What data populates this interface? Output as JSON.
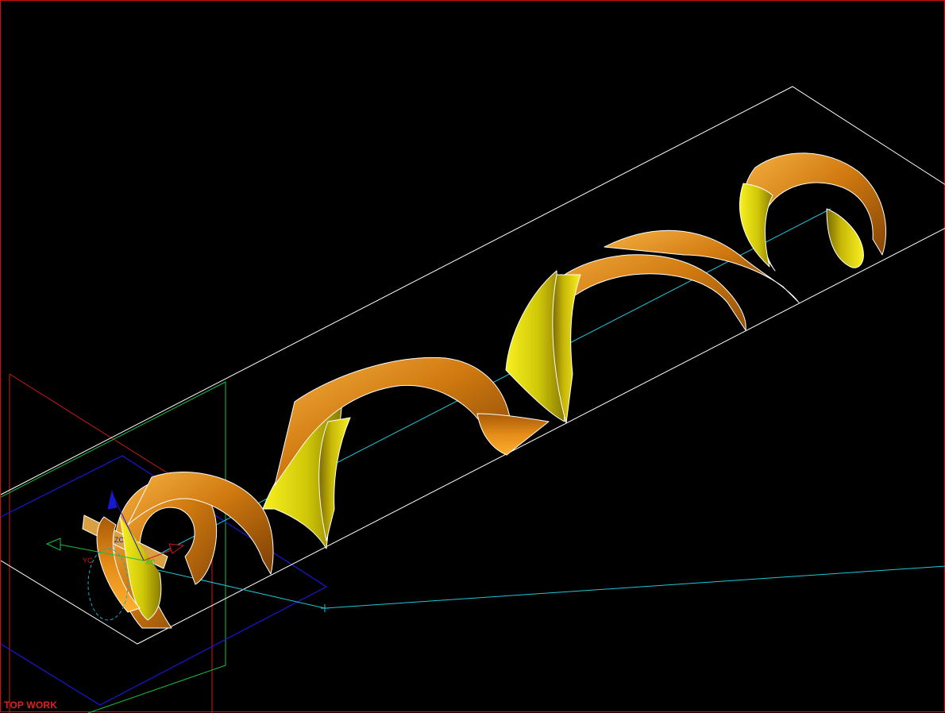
{
  "viewport": {
    "view_label": "TOP WORK"
  },
  "triad": {
    "zc_label": "ZC",
    "yc_label": "YC",
    "xc_label": "XC"
  },
  "colors": {
    "border": "#d01010",
    "bounding_box": "#ffffff",
    "helix_axis": "#20c8d8",
    "plane_red": "#d01818",
    "plane_green": "#18c040",
    "plane_blue": "#1818d0",
    "spiral_orange": "#e08a10",
    "spiral_yellow": "#e8e010"
  },
  "icons": {
    "wcs_triad": "wcs-triad-icon"
  }
}
